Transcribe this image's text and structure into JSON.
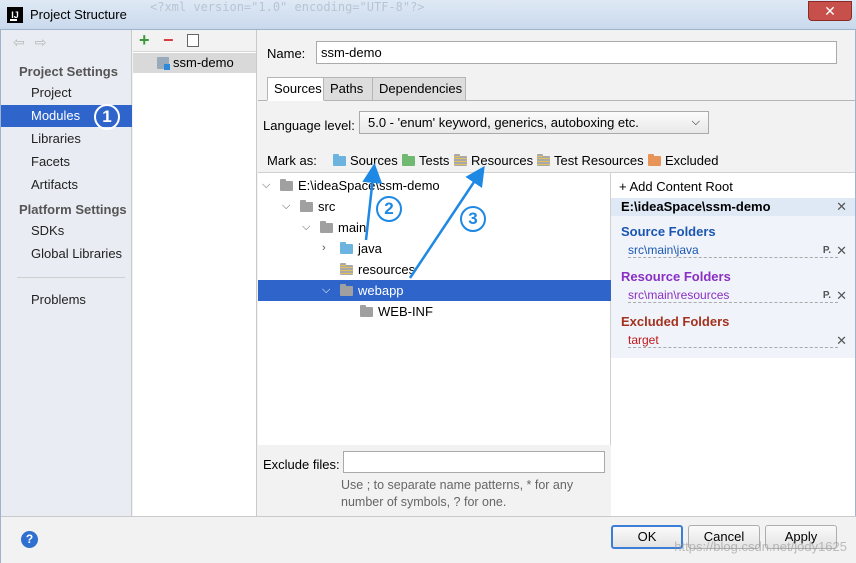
{
  "window": {
    "title": "Project Structure",
    "background_text": "<?xml version=\"1.0\" encoding=\"UTF-8\"?>",
    "close_symbol": "✕"
  },
  "sidebar": {
    "nav_back": "⇦",
    "nav_forward": "⇨",
    "project_settings_heading": "Project Settings",
    "project_items": [
      "Project",
      "Modules",
      "Libraries",
      "Facets",
      "Artifacts"
    ],
    "selected": "Modules",
    "platform_settings_heading": "Platform Settings",
    "platform_items": [
      "SDKs",
      "Global Libraries"
    ],
    "problems": "Problems"
  },
  "modules": {
    "add_symbol": "+",
    "remove_symbol": "−",
    "items": [
      "ssm-demo"
    ]
  },
  "module": {
    "name_label": "Name:",
    "name_value": "ssm-demo",
    "tabs": [
      "Sources",
      "Paths",
      "Dependencies"
    ],
    "active_tab": "Sources",
    "language_level_label": "Language level:",
    "language_level_value": "5.0 - 'enum' keyword, generics, autoboxing etc.",
    "mark_as_label": "Mark as:",
    "mark_as": [
      "Sources",
      "Tests",
      "Resources",
      "Test Resources",
      "Excluded"
    ]
  },
  "tree": {
    "root": "E:\\ideaSpace\\ssm-demo",
    "nodes": [
      "src",
      "main",
      "java",
      "resources",
      "webapp",
      "WEB-INF"
    ],
    "selected": "webapp"
  },
  "content_roots": {
    "add_label": "Add Content Root",
    "root_path": "E:\\ideaSpace\\ssm-demo",
    "source_heading": "Source Folders",
    "source_path": "src\\main\\java",
    "resource_heading": "Resource Folders",
    "resource_path": "src\\main\\resources",
    "excluded_heading": "Excluded Folders",
    "excluded_path": "target",
    "colors": {
      "source": "#1a56b0",
      "resource": "#8a2ec4",
      "excluded": "#a3321f"
    }
  },
  "exclude": {
    "label": "Exclude files:",
    "value": "",
    "hint_line1": "Use ; to separate name patterns, * for any",
    "hint_line2": "number of symbols, ? for one."
  },
  "footer": {
    "help_symbol": "?",
    "ok": "OK",
    "cancel": "Cancel",
    "apply": "Apply",
    "watermark": "https://blog.csdn.net/jody1625"
  },
  "annotations": {
    "c1": "1",
    "c2": "2",
    "c3": "3",
    "color": "#1e88e5"
  }
}
